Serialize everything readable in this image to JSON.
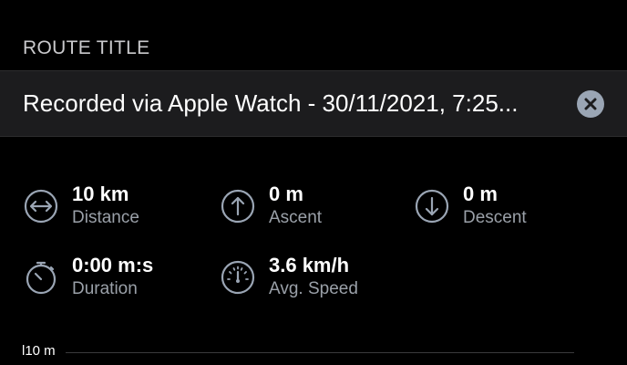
{
  "route_title": {
    "section_label": "ROUTE TITLE",
    "value": "Recorded via Apple Watch - 30/11/2021, 7:25..."
  },
  "stats": {
    "distance": {
      "value": "10 km",
      "label": "Distance",
      "icon": "distance-arrows-icon"
    },
    "ascent": {
      "value": "0 m",
      "label": "Ascent",
      "icon": "arrow-up-circle-icon"
    },
    "descent": {
      "value": "0 m",
      "label": "Descent",
      "icon": "arrow-down-circle-icon"
    },
    "duration": {
      "value": "0:00 m:s",
      "label": "Duration",
      "icon": "stopwatch-icon"
    },
    "avg_speed": {
      "value": "3.6 km/h",
      "label": "Avg. Speed",
      "icon": "speedometer-icon"
    }
  },
  "elevation_chart": {
    "axis_label": "l10 m"
  },
  "colors": {
    "background": "#000000",
    "field_background": "#1c1c1e",
    "icon_stroke": "#9aa5b4",
    "secondary_text": "#9aa0a8"
  }
}
